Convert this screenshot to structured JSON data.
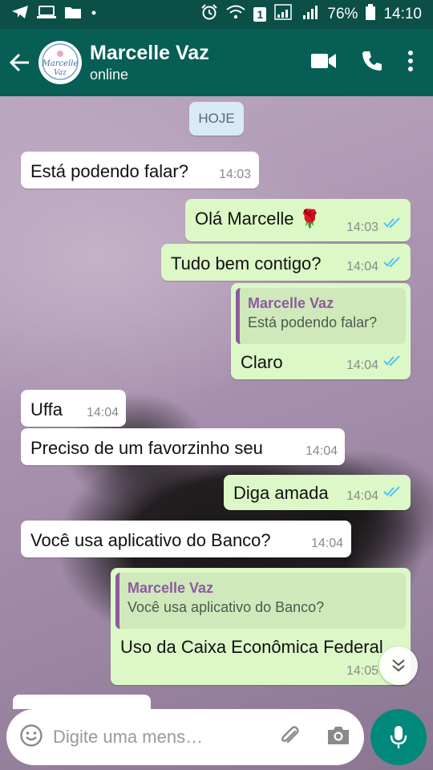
{
  "status_bar": {
    "battery": "76%",
    "time": "14:10",
    "sim": "1"
  },
  "header": {
    "contact_name": "Marcelle Vaz",
    "status": "online",
    "avatar_text": "Marcelle Vaz"
  },
  "chat": {
    "day_label": "HOJE",
    "messages": [
      {
        "dir": "in",
        "text": "Está podendo falar?",
        "time": "14:03"
      },
      {
        "dir": "out",
        "text": "Olá Marcelle 🌹",
        "time": "14:03",
        "read": true
      },
      {
        "dir": "out",
        "text": "Tudo bem contigo?",
        "time": "14:04",
        "read": true
      },
      {
        "dir": "out",
        "text": "Claro",
        "time": "14:04",
        "read": true,
        "reply_to": {
          "name": "Marcelle Vaz",
          "text": "Está podendo falar?"
        }
      },
      {
        "dir": "in",
        "text": "Uffa",
        "time": "14:04"
      },
      {
        "dir": "in",
        "text": "Preciso de um favorzinho seu",
        "time": "14:04"
      },
      {
        "dir": "out",
        "text": "Diga amada",
        "time": "14:04",
        "read": true
      },
      {
        "dir": "in",
        "text": "Você usa aplicativo do Banco?",
        "time": "14:04"
      },
      {
        "dir": "out",
        "text": "Uso da Caixa Econômica Federal",
        "time": "14:05",
        "read": true,
        "reply_to": {
          "name": "Marcelle Vaz",
          "text": "Você usa aplicativo do Banco?"
        }
      }
    ]
  },
  "composer": {
    "placeholder": "Digite uma mens…"
  },
  "colors": {
    "header": "#075e54",
    "status_bar": "#0b4f47",
    "outgoing_bubble": "#dcf8c6",
    "incoming_bubble": "#ffffff",
    "read_ticks": "#4fc3f7",
    "mic_button": "#00897b",
    "reply_name": "#8e5aa0"
  }
}
